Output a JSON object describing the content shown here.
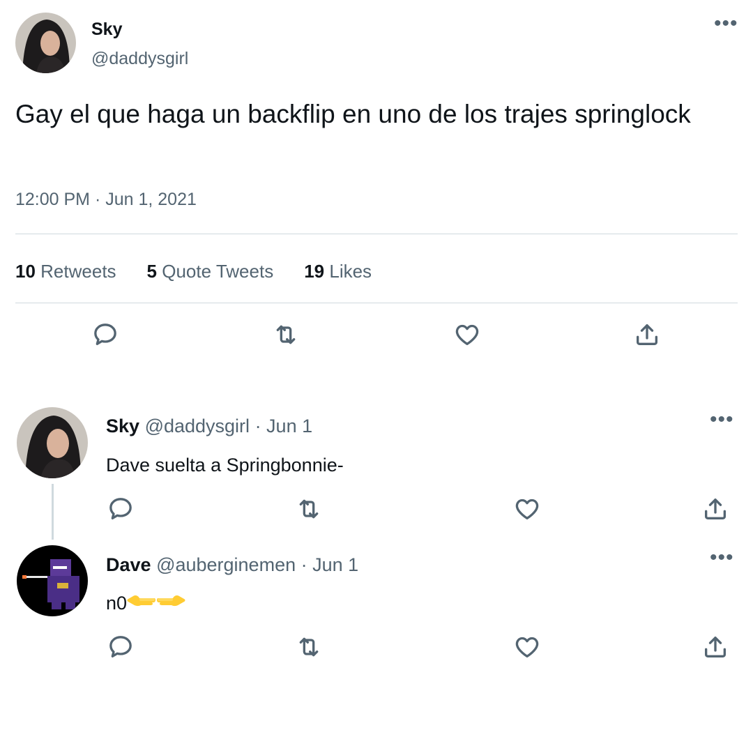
{
  "tweet": {
    "author_name": "Sky",
    "author_handle": "@daddysgirl",
    "text": "Gay el que haga un backflip en uno de los trajes springlock",
    "timestamp": "12:00 PM · Jun 1, 2021",
    "more_icon": "more-dots-icon",
    "stats": {
      "retweets_count": "10",
      "retweets_label": "Retweets",
      "quotes_count": "5",
      "quotes_label": "Quote Tweets",
      "likes_count": "19",
      "likes_label": "Likes"
    },
    "actions": [
      "reply-icon",
      "retweet-icon",
      "like-icon",
      "share-icon"
    ]
  },
  "replies": [
    {
      "name": "Sky",
      "handle": "@daddysgirl",
      "date": "· Jun 1",
      "text": "Dave suelta a Springbonnie-"
    },
    {
      "name": "Dave",
      "handle": "@auberginemen",
      "date": "· Jun 1",
      "text": "n0",
      "emoji": [
        "backhand-index-pointing-left-emoji",
        "backhand-index-pointing-right-emoji"
      ]
    }
  ],
  "colors": {
    "text": "#0f1419",
    "secondary": "#536471",
    "divider": "#cfd9de",
    "emoji": "#ffcc33"
  }
}
